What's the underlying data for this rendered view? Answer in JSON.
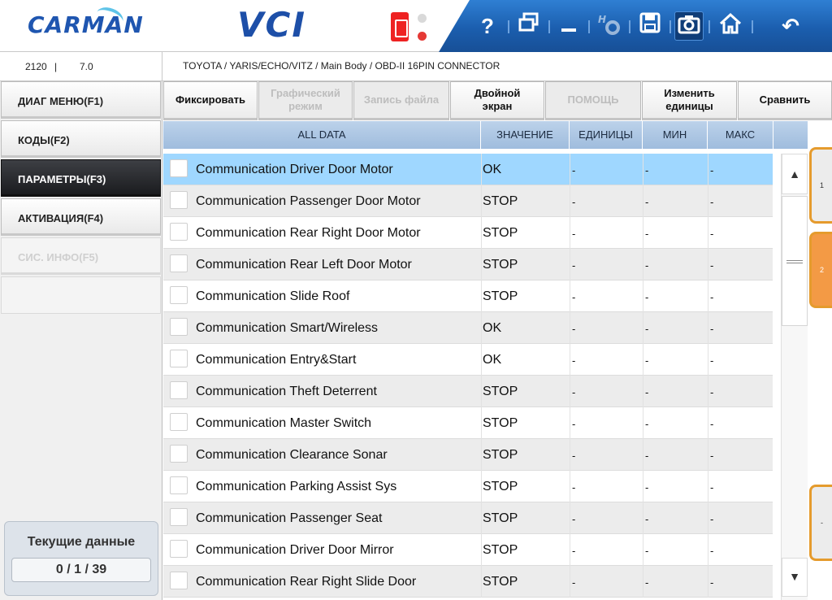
{
  "header": {
    "logo": "CARMAN",
    "product": "VCI",
    "toolbar_icons": [
      "help-icon",
      "window-switch-icon",
      "minimize-icon",
      "settings-icon",
      "save-icon",
      "camera-icon",
      "home-icon",
      "back-icon"
    ],
    "help_glyph": "?",
    "back_glyph": "↶"
  },
  "info": {
    "vehicle_num": "2120",
    "separator": "|",
    "version": "7.0",
    "breadcrumb": "TOYOTA / YARIS/ECHO/VITZ / Main Body / OBD-II 16PIN CONNECTOR"
  },
  "sidebar": {
    "items": [
      {
        "label": "ДИАГ МЕНЮ(F1)",
        "state": "normal"
      },
      {
        "label": "КОДЫ(F2)",
        "state": "normal"
      },
      {
        "label": "ПАРАМЕТРЫ(F3)",
        "state": "active"
      },
      {
        "label": "АКТИВАЦИЯ(F4)",
        "state": "normal"
      },
      {
        "label": "СИС. ИНФО(F5)",
        "state": "disabled"
      }
    ],
    "status_title": "Текущие данные",
    "status_value": "0 / 1 / 39"
  },
  "function_buttons": {
    "fix": "Фиксировать",
    "graph_1": "Графический",
    "graph_2": "режим",
    "record": "Запись файла",
    "dual_1": "Двойной",
    "dual_2": "экран",
    "help": "ПОМОЩЬ",
    "units_1": "Изменить",
    "units_2": "единицы",
    "compare": "Сравнить"
  },
  "table": {
    "headers": {
      "name": "ALL DATA",
      "value": "ЗНАЧЕНИЕ",
      "units": "ЕДИНИЦЫ",
      "min": "МИН",
      "max": "МАКС"
    },
    "rows": [
      {
        "name": "Communication Driver Door Motor",
        "value": "OK",
        "units": "-",
        "min": "-",
        "max": "-"
      },
      {
        "name": "Communication Passenger Door Motor",
        "value": "STOP",
        "units": "-",
        "min": "-",
        "max": "-"
      },
      {
        "name": "Communication Rear Right Door Motor",
        "value": "STOP",
        "units": "-",
        "min": "-",
        "max": "-"
      },
      {
        "name": "Communication Rear Left Door Motor",
        "value": "STOP",
        "units": "-",
        "min": "-",
        "max": "-"
      },
      {
        "name": "Communication Slide Roof",
        "value": "STOP",
        "units": "-",
        "min": "-",
        "max": "-"
      },
      {
        "name": "Communication Smart/Wireless",
        "value": "OK",
        "units": "-",
        "min": "-",
        "max": "-"
      },
      {
        "name": "Communication Entry&Start",
        "value": "OK",
        "units": "-",
        "min": "-",
        "max": "-"
      },
      {
        "name": "Communication Theft Deterrent",
        "value": "STOP",
        "units": "-",
        "min": "-",
        "max": "-"
      },
      {
        "name": "Communication Master Switch",
        "value": "STOP",
        "units": "-",
        "min": "-",
        "max": "-"
      },
      {
        "name": "Communication Clearance Sonar",
        "value": "STOP",
        "units": "-",
        "min": "-",
        "max": "-"
      },
      {
        "name": "Communication Parking Assist Sys",
        "value": "STOP",
        "units": "-",
        "min": "-",
        "max": "-"
      },
      {
        "name": "Communication Passenger Seat",
        "value": "STOP",
        "units": "-",
        "min": "-",
        "max": "-"
      },
      {
        "name": "Communication Driver Door Mirror",
        "value": "STOP",
        "units": "-",
        "min": "-",
        "max": "-"
      },
      {
        "name": "Communication Rear Right Slide Door",
        "value": "STOP",
        "units": "-",
        "min": "-",
        "max": "-"
      }
    ],
    "selected_index": 0
  },
  "scroll": {
    "up": "▲",
    "down": "▼"
  },
  "page_tabs": {
    "tab1": "1",
    "tab2": "2",
    "tab3": "-"
  },
  "colors": {
    "accent": "#1b5eae",
    "selected_row": "#9fd7ff",
    "tab_orange": "#f39a45"
  }
}
